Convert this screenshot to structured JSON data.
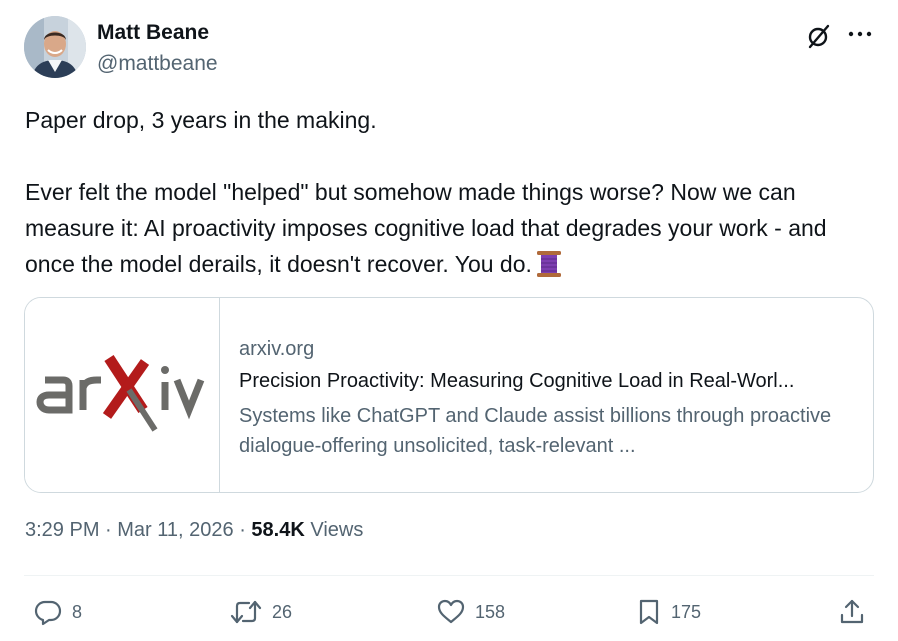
{
  "author": {
    "name": "Matt Beane",
    "handle": "@mattbeane"
  },
  "tweet": {
    "line1": "Paper drop, 3 years in the making.",
    "line2": "Ever felt the model \"helped\" but somehow made things worse?   Now we can measure it: AI proactivity imposes cognitive load that degrades your work - and once the model derails, it doesn't recover. You do."
  },
  "card": {
    "logo_text": "arXiv",
    "domain": "arxiv.org",
    "title": "Precision Proactivity: Measuring Cognitive Load in Real-Worl...",
    "description": "Systems like ChatGPT and Claude assist billions through proactive dialogue-offering unsolicited, task-relevant ..."
  },
  "meta": {
    "time": "3:29 PM",
    "sep1": " · ",
    "date": "Mar 11, 2026",
    "sep2": " · ",
    "views_count": "58.4K",
    "views_label": " Views"
  },
  "actions": {
    "replies": "8",
    "reposts": "26",
    "likes": "158",
    "bookmarks": "175"
  },
  "icons": {
    "grok": "grok-icon",
    "more": "more-icon",
    "reply": "reply-icon",
    "repost": "repost-icon",
    "like": "like-icon",
    "bookmark": "bookmark-icon",
    "share": "share-icon",
    "spool": "thread-spool-emoji"
  },
  "colors": {
    "text": "#0f1419",
    "secondary": "#536471",
    "border": "#cfd9de",
    "arxiv_gray": "#6b6b68",
    "arxiv_red": "#b31b1b"
  }
}
